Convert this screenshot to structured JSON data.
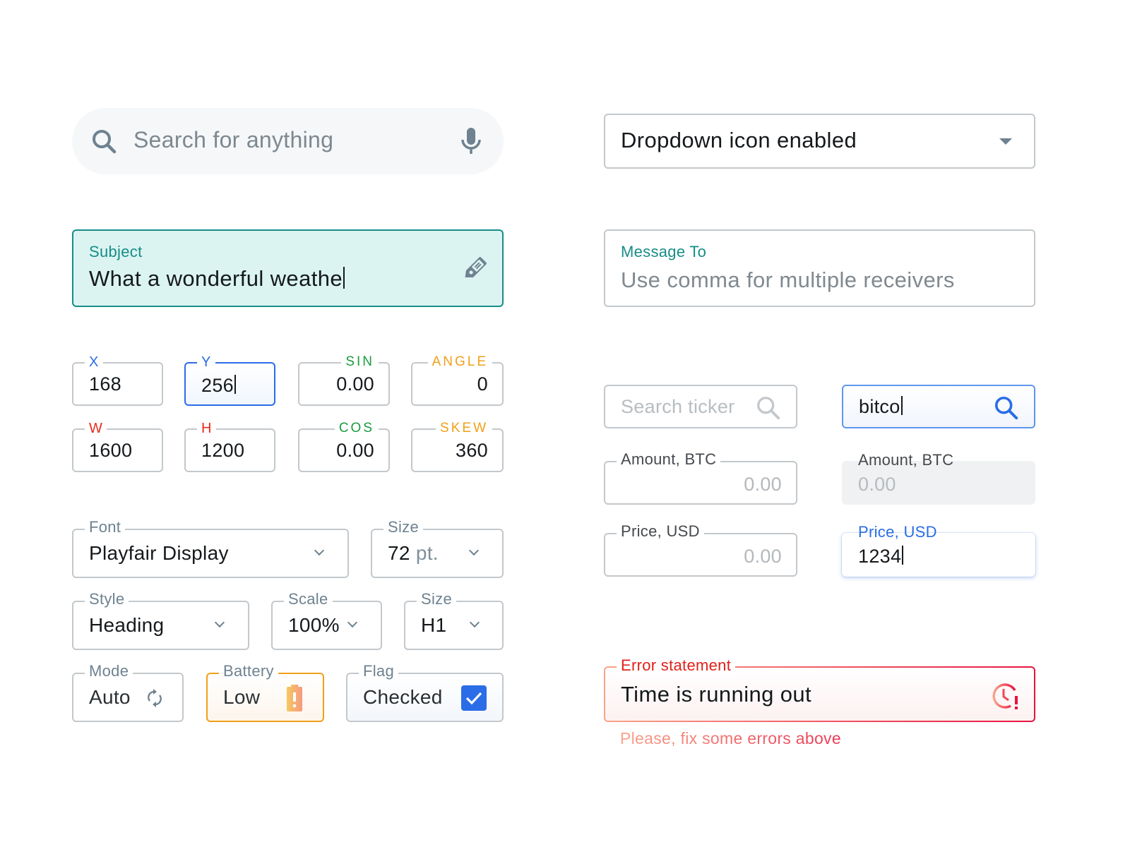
{
  "search": {
    "placeholder": "Search for anything",
    "icons": [
      "search-icon",
      "microphone-icon"
    ]
  },
  "subject_field": {
    "label": "Subject",
    "value": "What a wonderful weathe",
    "icon": "tag-icon",
    "accent": "#168d87",
    "background": "#dbf4f1"
  },
  "dropdown_field": {
    "value": "Dropdown icon enabled",
    "icon": "triangle-down-icon"
  },
  "message_to": {
    "label": "Message To",
    "placeholder": "Use comma for multiple receivers"
  },
  "transform": {
    "x": {
      "label": "X",
      "value": "168",
      "color": "#2a6de6"
    },
    "y": {
      "label": "Y",
      "value": "256",
      "color": "#2a6de6",
      "focused": true
    },
    "sin": {
      "label": "SIN",
      "value": "0.00",
      "color": "#1b9b3e"
    },
    "angle": {
      "label": "ANGLE",
      "value": "0",
      "color": "#f0a01a"
    },
    "w": {
      "label": "W",
      "value": "1600",
      "color": "#e52a1e"
    },
    "h": {
      "label": "H",
      "value": "1200",
      "color": "#e52a1e"
    },
    "cos": {
      "label": "COS",
      "value": "0.00",
      "color": "#1b9b3e"
    },
    "skew": {
      "label": "SKEW",
      "value": "360",
      "color": "#f0a01a"
    }
  },
  "typography": {
    "font": {
      "label": "Font",
      "value": "Playfair Display"
    },
    "size": {
      "label": "Size",
      "value": "72",
      "unit": "pt."
    },
    "style": {
      "label": "Style",
      "value": "Heading"
    },
    "scale": {
      "label": "Scale",
      "value": "100%"
    },
    "size2": {
      "label": "Size",
      "value": "H1"
    },
    "mode": {
      "label": "Mode",
      "value": "Auto",
      "icon": "refresh-icon"
    },
    "battery": {
      "label": "Battery",
      "value": "Low",
      "icon": "battery-alert-icon",
      "color": "#f0a01a"
    },
    "flag": {
      "label": "Flag",
      "value": "Checked",
      "checked": true,
      "color": "#2a6de6"
    }
  },
  "crypto": {
    "ticker_search": {
      "placeholder": "Search ticker"
    },
    "ticker_search_active": {
      "value": "bitco"
    },
    "amount": {
      "label": "Amount, BTC",
      "value": "0.00"
    },
    "amount_disabled": {
      "label": "Amount, BTC",
      "value": "0.00"
    },
    "price": {
      "label": "Price, USD",
      "value": "0.00"
    },
    "price_focused": {
      "label": "Price, USD",
      "value": "1234"
    }
  },
  "error_field": {
    "label": "Error statement",
    "value": "Time is running out",
    "icon": "clock-alert-icon",
    "helper": "Please, fix some errors above",
    "color": "#e8123f"
  }
}
